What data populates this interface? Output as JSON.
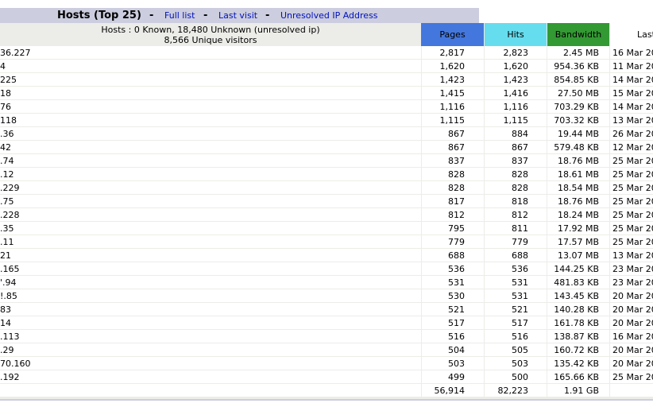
{
  "header": {
    "title": "Hosts (Top 25)",
    "sep": "-",
    "links": [
      "Full list",
      "Last visit",
      "Unresolved IP Address"
    ]
  },
  "table": {
    "hosts_summary": "Hosts : 0 Known, 18,480 Unknown (unresolved ip)",
    "unique_visitors": "8,566 Unique visitors",
    "columns": {
      "pages": "Pages",
      "hits": "Hits",
      "bandwidth": "Bandwidth",
      "last": "Last"
    },
    "rows": [
      {
        "host": "36.227",
        "pages": "2,817",
        "hits": "2,823",
        "bw": "2.45 MB",
        "last": "16 Mar 20"
      },
      {
        "host": "4",
        "pages": "1,620",
        "hits": "1,620",
        "bw": "954.36 KB",
        "last": "11 Mar 20"
      },
      {
        "host": "225",
        "pages": "1,423",
        "hits": "1,423",
        "bw": "854.85 KB",
        "last": "14 Mar 20"
      },
      {
        "host": "18",
        "pages": "1,415",
        "hits": "1,416",
        "bw": "27.50 MB",
        "last": "15 Mar 20"
      },
      {
        "host": "76",
        "pages": "1,116",
        "hits": "1,116",
        "bw": "703.29 KB",
        "last": "14 Mar 20"
      },
      {
        "host": "118",
        "pages": "1,115",
        "hits": "1,115",
        "bw": "703.32 KB",
        "last": "13 Mar 20"
      },
      {
        "host": ".36",
        "pages": "867",
        "hits": "884",
        "bw": "19.44 MB",
        "last": "26 Mar 20"
      },
      {
        "host": "42",
        "pages": "867",
        "hits": "867",
        "bw": "579.48 KB",
        "last": "12 Mar 20"
      },
      {
        "host": ".74",
        "pages": "837",
        "hits": "837",
        "bw": "18.76 MB",
        "last": "25 Mar 20"
      },
      {
        "host": ".12",
        "pages": "828",
        "hits": "828",
        "bw": "18.61 MB",
        "last": "25 Mar 20"
      },
      {
        "host": ".229",
        "pages": "828",
        "hits": "828",
        "bw": "18.54 MB",
        "last": "25 Mar 20"
      },
      {
        "host": ".75",
        "pages": "817",
        "hits": "818",
        "bw": "18.76 MB",
        "last": "25 Mar 20"
      },
      {
        "host": ".228",
        "pages": "812",
        "hits": "812",
        "bw": "18.24 MB",
        "last": "25 Mar 20"
      },
      {
        "host": ".35",
        "pages": "795",
        "hits": "811",
        "bw": "17.92 MB",
        "last": "25 Mar 20"
      },
      {
        "host": ".11",
        "pages": "779",
        "hits": "779",
        "bw": "17.57 MB",
        "last": "25 Mar 20"
      },
      {
        "host": "21",
        "pages": "688",
        "hits": "688",
        "bw": "13.07 MB",
        "last": "13 Mar 20"
      },
      {
        "host": ".165",
        "pages": "536",
        "hits": "536",
        "bw": "144.25 KB",
        "last": "23 Mar 20"
      },
      {
        "host": "'.94",
        "pages": "531",
        "hits": "531",
        "bw": "481.83 KB",
        "last": "23 Mar 20"
      },
      {
        "host": "!.85",
        "pages": "530",
        "hits": "531",
        "bw": "143.45 KB",
        "last": "20 Mar 20"
      },
      {
        "host": "83",
        "pages": "521",
        "hits": "521",
        "bw": "140.28 KB",
        "last": "20 Mar 20"
      },
      {
        "host": "14",
        "pages": "517",
        "hits": "517",
        "bw": "161.78 KB",
        "last": "20 Mar 20"
      },
      {
        "host": ".113",
        "pages": "516",
        "hits": "516",
        "bw": "138.87 KB",
        "last": "16 Mar 20"
      },
      {
        "host": ".29",
        "pages": "504",
        "hits": "505",
        "bw": "160.72 KB",
        "last": "20 Mar 20"
      },
      {
        "host": "70.160",
        "pages": "503",
        "hits": "503",
        "bw": "135.42 KB",
        "last": "20 Mar 20"
      },
      {
        "host": ".192",
        "pages": "499",
        "hits": "500",
        "bw": "165.66 KB",
        "last": "25 Mar 20"
      }
    ],
    "total": {
      "pages": "56,914",
      "hits": "82,223",
      "bw": "1.91 GB"
    }
  }
}
